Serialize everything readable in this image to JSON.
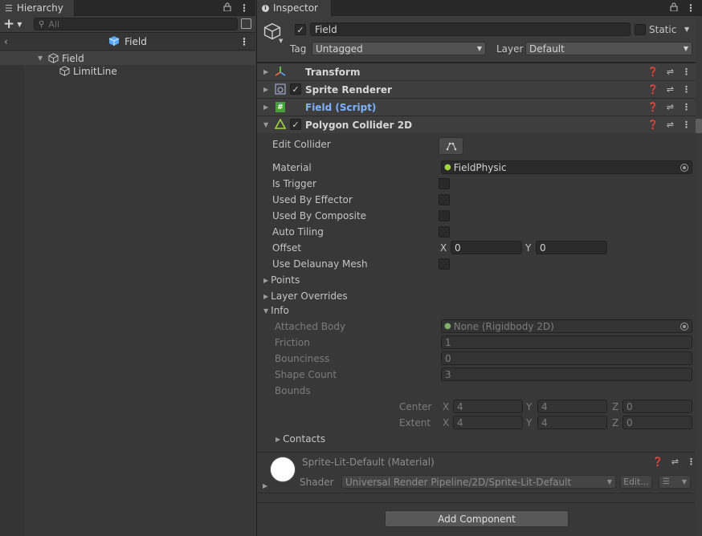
{
  "hierarchy": {
    "tab_label": "Hierarchy",
    "add_label": "+",
    "search_placeholder": "All",
    "scene_name": "Field",
    "items": [
      {
        "label": "Field"
      },
      {
        "label": "LimitLine"
      }
    ]
  },
  "inspector": {
    "tab_label": "Inspector",
    "object_name": "Field",
    "static_label": "Static",
    "tag_label": "Tag",
    "tag_value": "Untagged",
    "layer_label": "Layer",
    "layer_value": "Default",
    "components": [
      {
        "name": "Transform"
      },
      {
        "name": "Sprite Renderer"
      },
      {
        "name": "Field (Script)"
      },
      {
        "name": "Polygon Collider 2D"
      }
    ],
    "collider": {
      "edit_collider": "Edit Collider",
      "material_label": "Material",
      "material_value": "FieldPhysic",
      "is_trigger": "Is Trigger",
      "used_by_effector": "Used By Effector",
      "used_by_composite": "Used By Composite",
      "auto_tiling": "Auto Tiling",
      "offset_label": "Offset",
      "offset_x_label": "X",
      "offset_x": "0",
      "offset_y_label": "Y",
      "offset_y": "0",
      "use_delaunay": "Use Delaunay Mesh",
      "points": "Points",
      "layer_overrides": "Layer Overrides",
      "info": "Info",
      "attached_body_label": "Attached Body",
      "attached_body_value": "None (Rigidbody 2D)",
      "friction_label": "Friction",
      "friction_value": "1",
      "bounciness_label": "Bounciness",
      "bounciness_value": "0",
      "shape_count_label": "Shape Count",
      "shape_count_value": "3",
      "bounds_label": "Bounds",
      "center_label": "Center",
      "center": {
        "x": "4",
        "y": "4",
        "z": "0"
      },
      "extent_label": "Extent",
      "extent": {
        "x": "4",
        "y": "4",
        "z": "0"
      },
      "axis": {
        "x": "X",
        "y": "Y",
        "z": "Z"
      },
      "contacts": "Contacts"
    },
    "material": {
      "title": "Sprite-Lit-Default (Material)",
      "shader_label": "Shader",
      "shader_value": "Universal Render Pipeline/2D/Sprite-Lit-Default",
      "edit_label": "Edit..."
    },
    "add_component_label": "Add Component"
  },
  "colors": {
    "panel_bg": "#383838",
    "header_bg": "#3c3c3c",
    "field_bg": "#2a2a2a",
    "link_blue": "#7fb3ff",
    "collider_green": "#9fd63c"
  }
}
